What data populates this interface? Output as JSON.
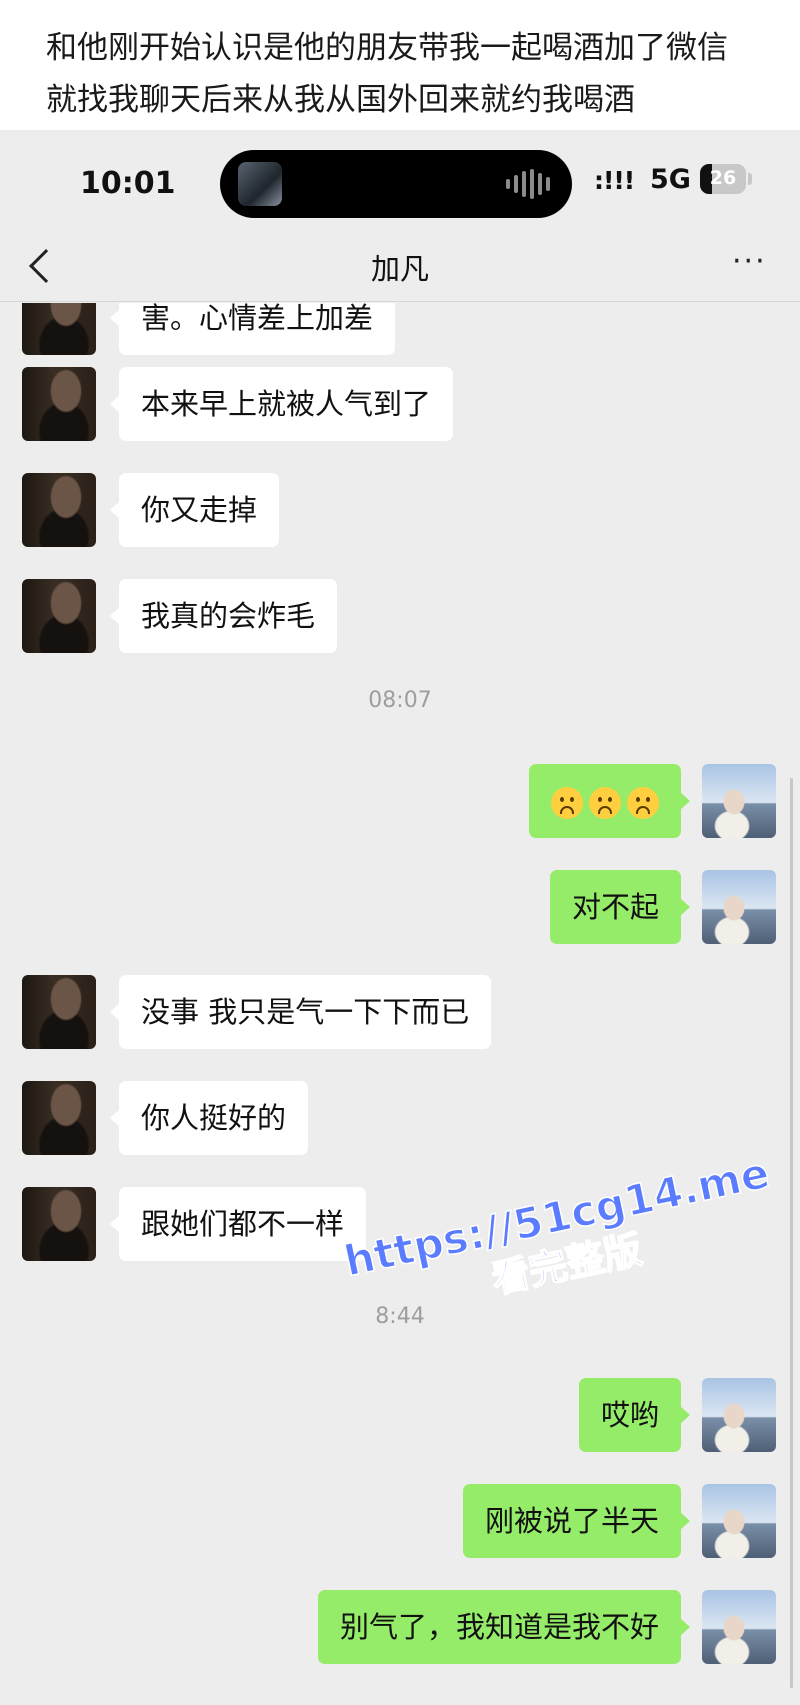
{
  "caption": {
    "line1": "和他刚开始认识是他的朋友带我一起喝酒加了微信",
    "line2": "就找我聊天后来从我从国外回来就约我喝酒"
  },
  "status_bar": {
    "time": "10:01",
    "signal": ":!!!",
    "network": "5G",
    "battery": "26"
  },
  "nav": {
    "title": "加凡",
    "more": "···"
  },
  "messages": [
    {
      "side": "in",
      "text": "害。心情差上加差"
    },
    {
      "side": "in",
      "text": "本来早上就被人气到了"
    },
    {
      "side": "in",
      "text": "你又走掉"
    },
    {
      "side": "in",
      "text": "我真的会炸毛"
    },
    {
      "type": "time",
      "text": "08:07"
    },
    {
      "side": "out",
      "emoji": [
        "frowning-face-emoji",
        "frowning-face-emoji",
        "frowning-face-emoji"
      ]
    },
    {
      "side": "out",
      "text": "对不起"
    },
    {
      "side": "in",
      "text": "没事 我只是气一下下而已"
    },
    {
      "side": "in",
      "text": "你人挺好的"
    },
    {
      "side": "in",
      "text": "跟她们都不一样"
    },
    {
      "type": "time",
      "text": "8:44"
    },
    {
      "side": "out",
      "text": "哎哟"
    },
    {
      "side": "out",
      "text": "刚被说了半天"
    },
    {
      "side": "out",
      "text": "别气了，我知道是我不好"
    }
  ],
  "watermark": {
    "url": "https://51cg14.me",
    "text": "看完整版"
  },
  "colors": {
    "outgoing_bubble": "#95ec69",
    "incoming_bubble": "#ffffff",
    "chat_background": "#ededed",
    "watermark": "#5b7cff"
  }
}
